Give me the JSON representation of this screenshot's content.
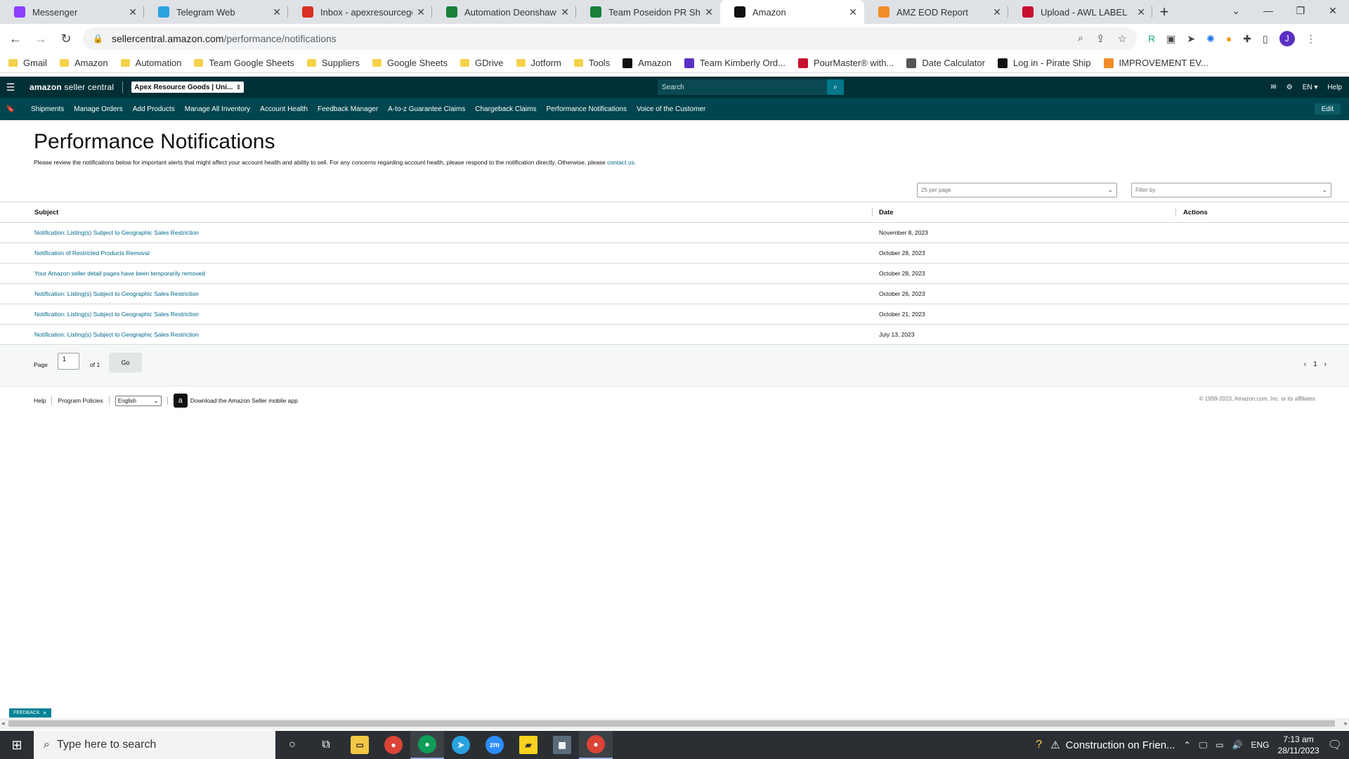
{
  "browser": {
    "tabs": [
      {
        "label": "Messenger",
        "favicon": "messenger-icon",
        "color": "#8a3ffc"
      },
      {
        "label": "Telegram Web",
        "favicon": "telegram-icon",
        "color": "#2aa3df"
      },
      {
        "label": "Inbox - apexresourcegoo",
        "favicon": "gmail-icon",
        "color": "#d93025"
      },
      {
        "label": "Automation Deonshawn S",
        "favicon": "sheets-icon",
        "color": "#188038"
      },
      {
        "label": "Team Poseidon PR Sheet",
        "favicon": "sheets-icon",
        "color": "#188038"
      },
      {
        "label": "Amazon",
        "favicon": "amazon-icon",
        "color": "#111111"
      },
      {
        "label": "AMZ EOD Report",
        "favicon": "clickup-icon",
        "color": "#f28c28"
      },
      {
        "label": "Upload - AWL LABEL",
        "favicon": "awl-icon",
        "color": "#c8102e"
      }
    ],
    "url_host": "sellercentral.amazon.com",
    "url_path": "/performance/notifications",
    "avatar_letter": "J",
    "bookmarks": [
      {
        "label": "Gmail",
        "type": "folder"
      },
      {
        "label": "Amazon",
        "type": "folder"
      },
      {
        "label": "Automation",
        "type": "folder"
      },
      {
        "label": "Team Google Sheets",
        "type": "folder"
      },
      {
        "label": "Suppliers",
        "type": "folder"
      },
      {
        "label": "Google Sheets",
        "type": "folder"
      },
      {
        "label": "GDrive",
        "type": "folder"
      },
      {
        "label": "Jotform",
        "type": "folder"
      },
      {
        "label": "Tools",
        "type": "folder"
      },
      {
        "label": "Amazon",
        "type": "site"
      },
      {
        "label": "Team Kimberly Ord...",
        "type": "site"
      },
      {
        "label": "PourMaster® with...",
        "type": "site"
      },
      {
        "label": "Date Calculator",
        "type": "site"
      },
      {
        "label": "Log in - Pirate Ship",
        "type": "site"
      },
      {
        "label": "IMPROVEMENT EV...",
        "type": "site"
      }
    ]
  },
  "seller_central": {
    "logo_bold": "amazon",
    "logo_rest": " seller central",
    "account": "Apex Resource Goods | Uni...",
    "search_placeholder": "Search",
    "lang": "EN",
    "help": "Help",
    "nav": [
      "Shipments",
      "Manage Orders",
      "Add Products",
      "Manage All Inventory",
      "Account Health",
      "Feedback Manager",
      "A-to-z Guarantee Claims",
      "Chargeback Claims",
      "Performance Notifications",
      "Voice of the Customer"
    ],
    "edit": "Edit"
  },
  "page": {
    "title": "Performance Notifications",
    "description": "Please review the notifications below for important alerts that might affect your account health and ability to sell. For any concerns regarding account health, please respond to the notification directly. Otherwise, please ",
    "contact_link": "contact us",
    "per_page": "25 per page",
    "filter_placeholder": "Filter by",
    "columns": {
      "subject": "Subject",
      "date": "Date",
      "actions": "Actions"
    },
    "rows": [
      {
        "subject": "Notification: Listing(s) Subject to Geographic Sales Restriction",
        "date": "November 8, 2023"
      },
      {
        "subject": "Notification of Restricted Products Removal",
        "date": "October 28, 2023"
      },
      {
        "subject": "Your Amazon seller detail pages have been temporarily removed",
        "date": "October 28, 2023"
      },
      {
        "subject": "Notification: Listing(s) Subject to Geographic Sales Restriction",
        "date": "October 26, 2023"
      },
      {
        "subject": "Notification: Listing(s) Subject to Geographic Sales Restriction",
        "date": "October 21, 2023"
      },
      {
        "subject": "Notification: Listing(s) Subject to Geographic Sales Restriction",
        "date": "July 13, 2023"
      }
    ],
    "pager": {
      "page_label": "Page",
      "page_value": "1",
      "of_label": "of 1",
      "go": "Go",
      "current": "1"
    },
    "footer": {
      "help": "Help",
      "policies": "Program Policies",
      "language": "English",
      "app": "Download the Amazon Seller mobile app",
      "copyright": "© 1999-2023, Amazon.com, Inc. or its affiliates"
    },
    "feedback": "FEEDBACK"
  },
  "taskbar": {
    "search_placeholder": "Type here to search",
    "weather": "Construction on Frien...",
    "lang": "ENG",
    "time": "7:13 am",
    "date": "28/11/2023"
  }
}
